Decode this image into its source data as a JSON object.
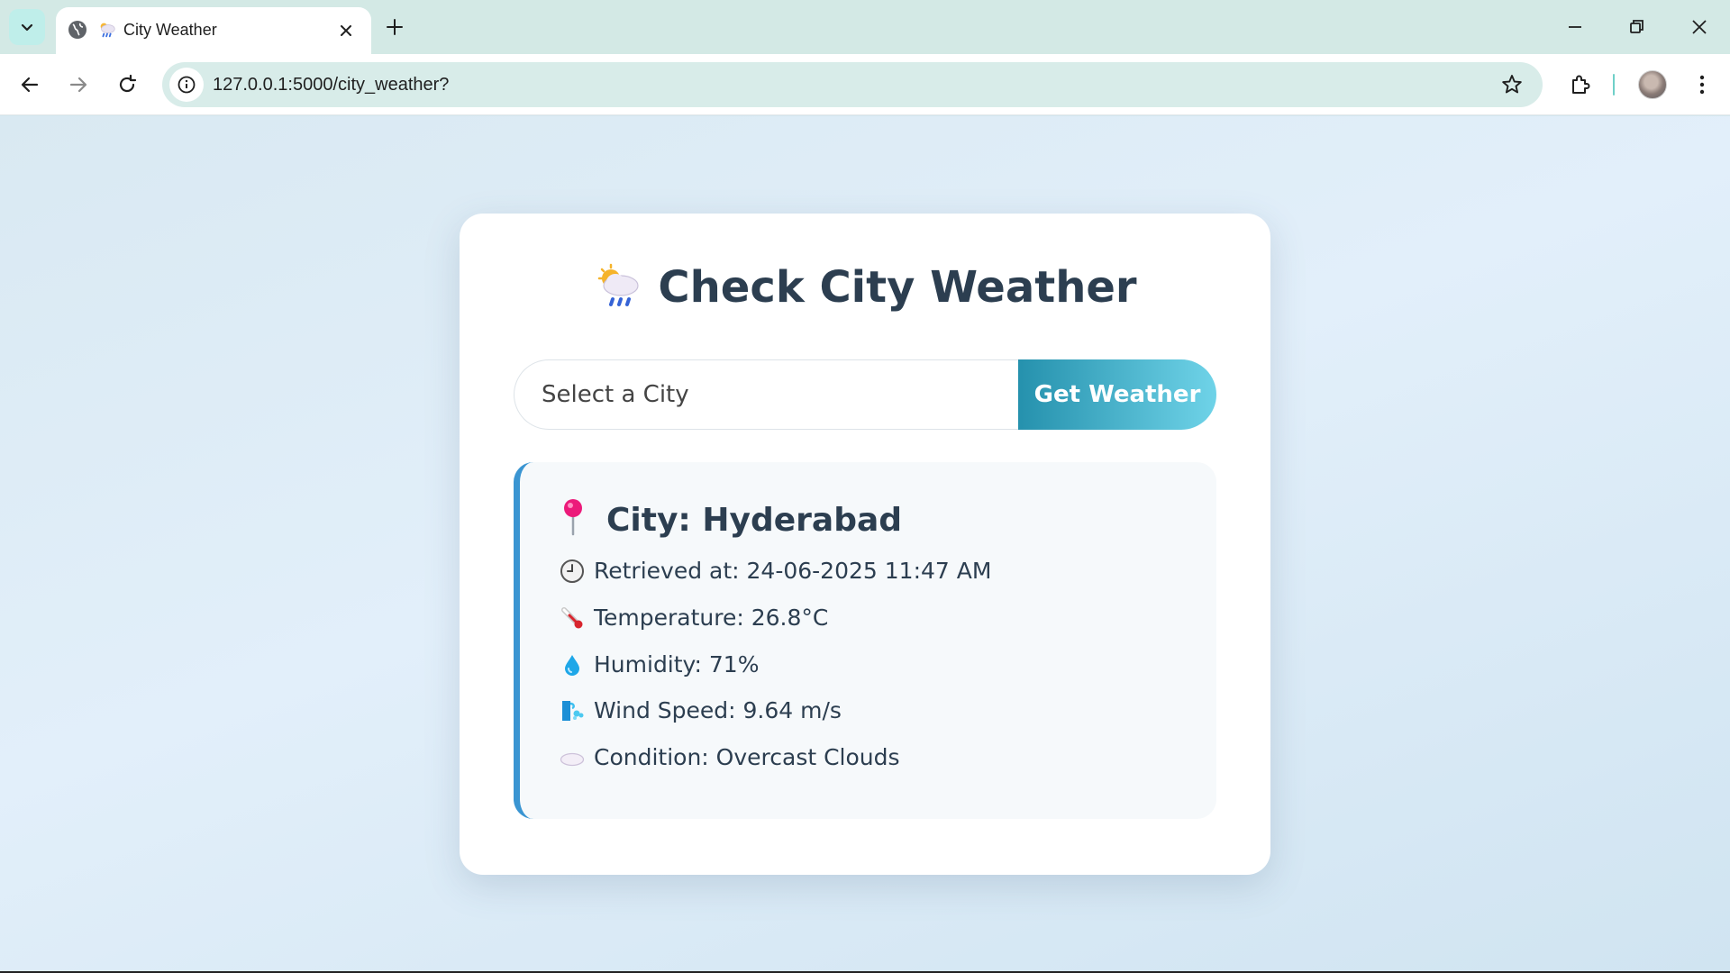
{
  "browser": {
    "tab_title": "City Weather",
    "url": "127.0.0.1:5000/city_weather?"
  },
  "page": {
    "heading": "Check City Weather",
    "input_placeholder": "Select a City",
    "button_label": "Get Weather",
    "result": {
      "city": "City: Hyderabad",
      "retrieved_at": "Retrieved at: 24-06-2025 11:47 AM",
      "temperature": "Temperature: 26.8°C",
      "humidity": "Humidity: 71%",
      "wind_speed": "Wind Speed: 9.64 m/s",
      "condition": "Condition: Overcast Clouds"
    }
  },
  "colors": {
    "button_gradient_start": "#2591ad",
    "button_gradient_end": "#6fd3e8",
    "result_accent": "#3a95d2",
    "heading": "#2c3e50"
  },
  "icons": {
    "title": "cloud-rain-sun-icon",
    "city": "pin-icon",
    "retrieved_at": "clock-icon",
    "temperature": "thermometer-icon",
    "humidity": "droplet-icon",
    "wind_speed": "wind-icon",
    "condition": "cloud-icon"
  }
}
